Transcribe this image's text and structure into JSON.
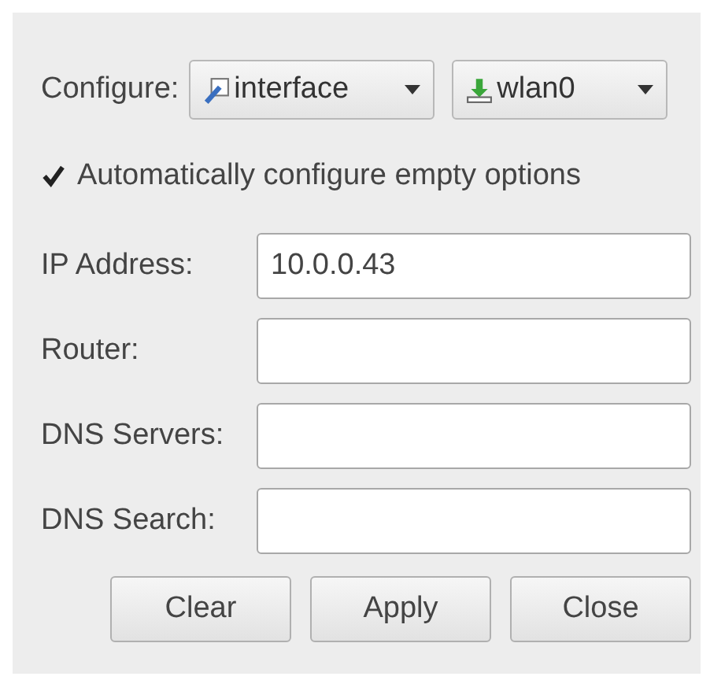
{
  "configure": {
    "label": "Configure:",
    "dropdowns": [
      {
        "kind": "interface",
        "value": "interface"
      },
      {
        "kind": "device",
        "value": "wlan0"
      }
    ]
  },
  "auto_configure": {
    "label": "Automatically configure empty options",
    "checked": true
  },
  "fields": [
    {
      "label": "IP Address:",
      "value": "10.0.0.43"
    },
    {
      "label": "Router:"
    },
    {
      "label": "DNS Servers:"
    },
    {
      "label": "DNS Search:"
    }
  ],
  "buttons": [
    "Clear",
    "Apply",
    "Close"
  ]
}
